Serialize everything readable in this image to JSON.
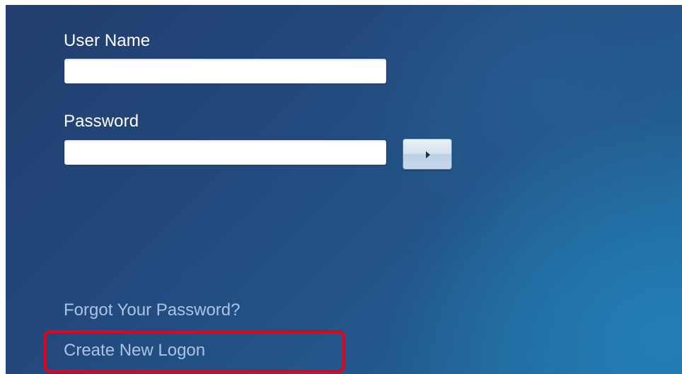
{
  "login": {
    "username_label": "User Name",
    "username_value": "",
    "password_label": "Password",
    "password_value": ""
  },
  "submit": {
    "icon": "arrow-right-icon"
  },
  "links": {
    "forgot_password": "Forgot Your Password?",
    "create_logon": "Create New Logon"
  },
  "colors": {
    "background_dark": "#213e6f",
    "background_light": "#1f6aa0",
    "label_text": "#ffffff",
    "link_text": "#a9c4e4",
    "highlight": "#e8001a"
  }
}
